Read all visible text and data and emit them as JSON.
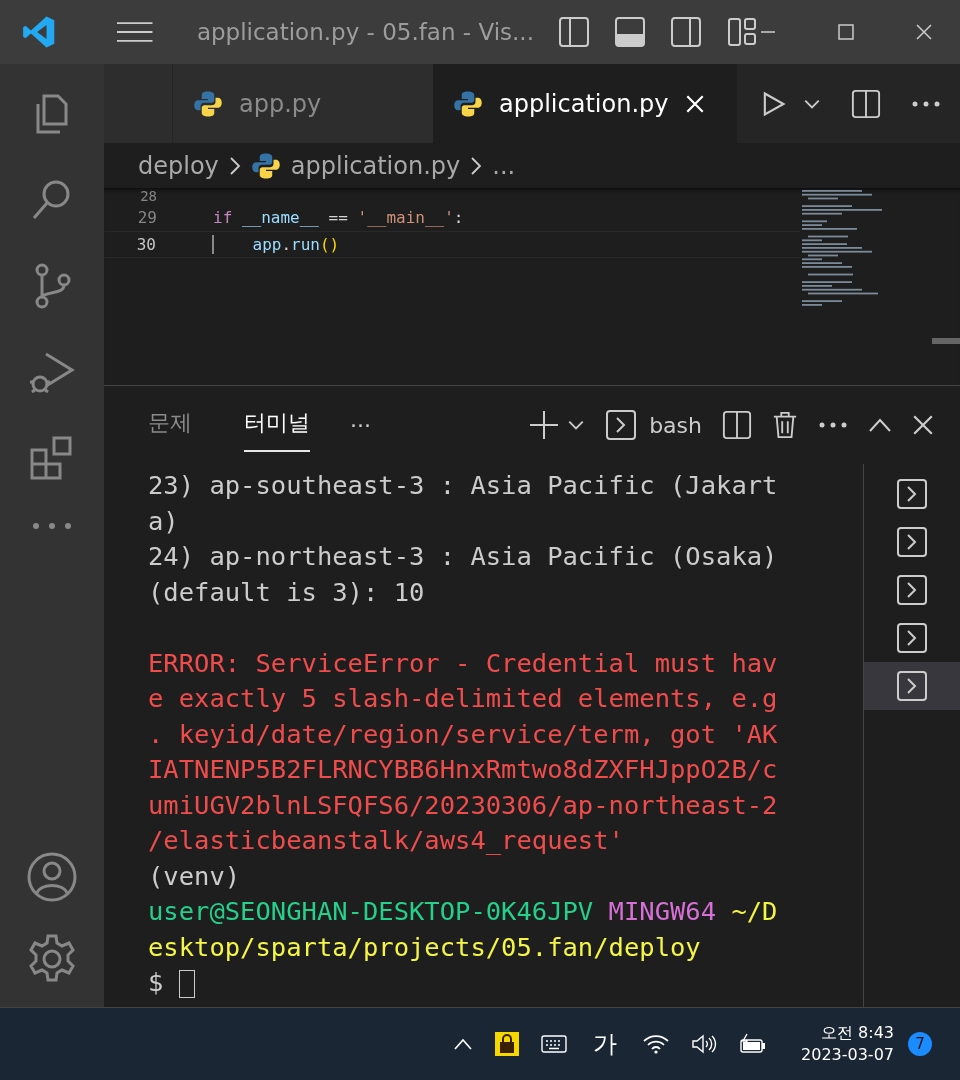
{
  "window": {
    "title": "application.py - 05.fan - Vis..."
  },
  "activity_bar": {
    "items": [
      {
        "kind": "files",
        "selected": false
      },
      {
        "kind": "search",
        "selected": false
      },
      {
        "kind": "source-control",
        "selected": false
      },
      {
        "kind": "run-debug",
        "selected": false
      },
      {
        "kind": "extensions",
        "selected": false
      },
      {
        "kind": "more",
        "selected": false
      }
    ],
    "bottom": [
      {
        "kind": "account"
      },
      {
        "kind": "settings"
      }
    ]
  },
  "tabs": [
    {
      "label": "app.py",
      "selected": false
    },
    {
      "label": "application.py",
      "selected": true
    }
  ],
  "breadcrumb": {
    "folder": "deploy",
    "file": "application.py",
    "more": "..."
  },
  "editor": {
    "lines": [
      {
        "number": "28",
        "current": false
      },
      {
        "number": "29",
        "current": false,
        "tokens": [
          {
            "kind": "keyword",
            "text": "if"
          },
          {
            "kind": "variable",
            "text": " __name__"
          },
          {
            "kind": "plain",
            "text": " =="
          },
          {
            "kind": "string",
            "text": " '__main__'"
          },
          {
            "kind": "plain",
            "text": ":"
          }
        ]
      },
      {
        "number": "30",
        "current": true,
        "tokens": [
          {
            "kind": "variable",
            "text": "    app"
          },
          {
            "kind": "plain",
            "text": "."
          },
          {
            "kind": "variable",
            "text": "run"
          },
          {
            "kind": "bracket",
            "text": "()"
          }
        ]
      }
    ]
  },
  "panel": {
    "tabs": [
      {
        "label": "문제",
        "selected": false
      },
      {
        "label": "터미널",
        "selected": true
      }
    ],
    "more": "···",
    "shell": "bash",
    "terminal_lines": [
      {
        "kind": "normal",
        "text": "23) ap-southeast-3 : Asia Pacific (Jakart"
      },
      {
        "kind": "normal",
        "text": "a)"
      },
      {
        "kind": "normal",
        "text": "24) ap-northeast-3 : Asia Pacific (Osaka)"
      },
      {
        "kind": "normal",
        "text": "(default is 3): 10"
      },
      {
        "kind": "blank"
      },
      {
        "kind": "error",
        "text": "ERROR: ServiceError - Credential must hav"
      },
      {
        "kind": "error",
        "text": "e exactly 5 slash-delimited elements, e.g"
      },
      {
        "kind": "error",
        "text": ". keyid/date/region/service/term, got 'AK"
      },
      {
        "kind": "error",
        "text": "IATNENP5B2FLRNCYBB6HnxRmtwo8dZXFHJppO2B/c"
      },
      {
        "kind": "error",
        "text": "umiUGV2blnLSFQFS6/20230306/ap-northeast-2"
      },
      {
        "kind": "error",
        "text": "/elasticbeanstalk/aws4_request'"
      },
      {
        "kind": "normal",
        "text": "(venv)"
      },
      {
        "kind": "prompt",
        "segments": [
          {
            "kind": "user",
            "text": "user@SEONGHAN-DESKTOP-0K46JPV"
          },
          {
            "kind": "system",
            "text": " MINGW64"
          },
          {
            "kind": "path",
            "text": " ~/D"
          }
        ]
      },
      {
        "kind": "path",
        "text": "esktop/sparta/projects/05.fan/deploy"
      },
      {
        "kind": "cursor",
        "text": "$"
      }
    ],
    "terminals": [
      {
        "selected": false
      },
      {
        "selected": false
      },
      {
        "selected": false
      },
      {
        "selected": false
      },
      {
        "selected": true
      }
    ]
  },
  "taskbar": {
    "ime": "가",
    "time": "오전 8:43",
    "date": "2023-03-07",
    "notifications": "7"
  }
}
